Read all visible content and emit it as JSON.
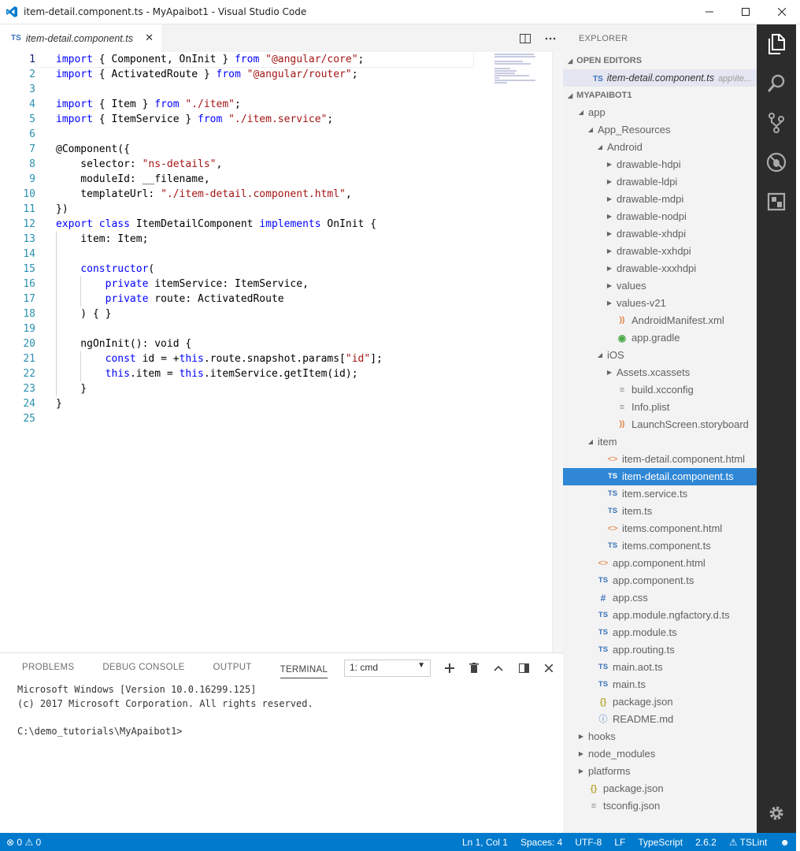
{
  "window": {
    "title": "item-detail.component.ts - MyApaibot1 - Visual Studio Code"
  },
  "tab": {
    "badge": "TS",
    "name": "item-detail.component.ts"
  },
  "editor": {
    "lines": [
      {
        "n": "1",
        "tokens": [
          [
            "kw",
            "import"
          ],
          [
            "t",
            " { Component, OnInit } "
          ],
          [
            "kw",
            "from"
          ],
          [
            "t",
            " "
          ],
          [
            "str",
            "\"@angular/core\""
          ],
          [
            "t",
            ";"
          ]
        ]
      },
      {
        "n": "2",
        "tokens": [
          [
            "kw",
            "import"
          ],
          [
            "t",
            " { ActivatedRoute } "
          ],
          [
            "kw",
            "from"
          ],
          [
            "t",
            " "
          ],
          [
            "str",
            "\"@angular/router\""
          ],
          [
            "t",
            ";"
          ]
        ]
      },
      {
        "n": "3",
        "tokens": []
      },
      {
        "n": "4",
        "tokens": [
          [
            "kw",
            "import"
          ],
          [
            "t",
            " { Item } "
          ],
          [
            "kw",
            "from"
          ],
          [
            "t",
            " "
          ],
          [
            "str",
            "\"./item\""
          ],
          [
            "t",
            ";"
          ]
        ]
      },
      {
        "n": "5",
        "tokens": [
          [
            "kw",
            "import"
          ],
          [
            "t",
            " { ItemService } "
          ],
          [
            "kw",
            "from"
          ],
          [
            "t",
            " "
          ],
          [
            "str",
            "\"./item.service\""
          ],
          [
            "t",
            ";"
          ]
        ]
      },
      {
        "n": "6",
        "tokens": []
      },
      {
        "n": "7",
        "tokens": [
          [
            "t",
            "@Component({"
          ]
        ]
      },
      {
        "n": "8",
        "tokens": [
          [
            "t",
            "    selector: "
          ],
          [
            "str",
            "\"ns-details\""
          ],
          [
            "t",
            ","
          ]
        ]
      },
      {
        "n": "9",
        "tokens": [
          [
            "t",
            "    moduleId: __filename,"
          ]
        ]
      },
      {
        "n": "10",
        "tokens": [
          [
            "t",
            "    templateUrl: "
          ],
          [
            "str",
            "\"./item-detail.component.html\""
          ],
          [
            "t",
            ","
          ]
        ]
      },
      {
        "n": "11",
        "tokens": [
          [
            "t",
            "})"
          ]
        ]
      },
      {
        "n": "12",
        "tokens": [
          [
            "kw",
            "export"
          ],
          [
            "t",
            " "
          ],
          [
            "kw",
            "class"
          ],
          [
            "t",
            " ItemDetailComponent "
          ],
          [
            "kw",
            "implements"
          ],
          [
            "t",
            " OnInit {"
          ]
        ]
      },
      {
        "n": "13",
        "tokens": [
          [
            "t",
            "    item: Item;"
          ]
        ]
      },
      {
        "n": "14",
        "tokens": []
      },
      {
        "n": "15",
        "tokens": [
          [
            "t",
            "    "
          ],
          [
            "kw",
            "constructor"
          ],
          [
            "t",
            "("
          ]
        ]
      },
      {
        "n": "16",
        "tokens": [
          [
            "t",
            "        "
          ],
          [
            "kw",
            "private"
          ],
          [
            "t",
            " itemService: ItemService,"
          ]
        ]
      },
      {
        "n": "17",
        "tokens": [
          [
            "t",
            "        "
          ],
          [
            "kw",
            "private"
          ],
          [
            "t",
            " route: ActivatedRoute"
          ]
        ]
      },
      {
        "n": "18",
        "tokens": [
          [
            "t",
            "    ) { }"
          ]
        ]
      },
      {
        "n": "19",
        "tokens": []
      },
      {
        "n": "20",
        "tokens": [
          [
            "t",
            "    ngOnInit(): void {"
          ]
        ]
      },
      {
        "n": "21",
        "tokens": [
          [
            "t",
            "        "
          ],
          [
            "kw",
            "const"
          ],
          [
            "t",
            " id = +"
          ],
          [
            "kw",
            "this"
          ],
          [
            "t",
            ".route.snapshot.params["
          ],
          [
            "str",
            "\"id\""
          ],
          [
            "t",
            "];"
          ]
        ]
      },
      {
        "n": "22",
        "tokens": [
          [
            "t",
            "        "
          ],
          [
            "kw",
            "this"
          ],
          [
            "t",
            ".item = "
          ],
          [
            "kw",
            "this"
          ],
          [
            "t",
            ".itemService.getItem(id);"
          ]
        ]
      },
      {
        "n": "23",
        "tokens": [
          [
            "t",
            "    }"
          ]
        ]
      },
      {
        "n": "24",
        "tokens": [
          [
            "t",
            "}"
          ]
        ]
      },
      {
        "n": "25",
        "tokens": []
      }
    ]
  },
  "panel": {
    "tabs": [
      "PROBLEMS",
      "DEBUG CONSOLE",
      "OUTPUT",
      "TERMINAL"
    ],
    "active_tab": "TERMINAL",
    "terminal_select": "1: cmd",
    "terminal_lines": [
      "Microsoft Windows [Version 10.0.16299.125]",
      "(c) 2017 Microsoft Corporation. All rights reserved.",
      "",
      "C:\\demo_tutorials\\MyApaibot1>"
    ]
  },
  "explorer": {
    "title": "EXPLORER",
    "open_editors_label": "OPEN EDITORS",
    "open_editor": {
      "badge": "TS",
      "name": "item-detail.component.ts",
      "path": "app\\ite..."
    },
    "project_label": "MYAPAIBOT1",
    "tree": [
      {
        "label": "app",
        "depth": 0,
        "twisty": "open",
        "icon": ""
      },
      {
        "label": "App_Resources",
        "depth": 1,
        "twisty": "open",
        "icon": ""
      },
      {
        "label": "Android",
        "depth": 2,
        "twisty": "open",
        "icon": ""
      },
      {
        "label": "drawable-hdpi",
        "depth": 3,
        "twisty": "closed",
        "icon": ""
      },
      {
        "label": "drawable-ldpi",
        "depth": 3,
        "twisty": "closed",
        "icon": ""
      },
      {
        "label": "drawable-mdpi",
        "depth": 3,
        "twisty": "closed",
        "icon": ""
      },
      {
        "label": "drawable-nodpi",
        "depth": 3,
        "twisty": "closed",
        "icon": ""
      },
      {
        "label": "drawable-xhdpi",
        "depth": 3,
        "twisty": "closed",
        "icon": ""
      },
      {
        "label": "drawable-xxhdpi",
        "depth": 3,
        "twisty": "closed",
        "icon": ""
      },
      {
        "label": "drawable-xxxhdpi",
        "depth": 3,
        "twisty": "closed",
        "icon": ""
      },
      {
        "label": "values",
        "depth": 3,
        "twisty": "closed",
        "icon": ""
      },
      {
        "label": "values-v21",
        "depth": 3,
        "twisty": "closed",
        "icon": ""
      },
      {
        "label": "AndroidManifest.xml",
        "depth": 3,
        "twisty": "none",
        "icon": "rss"
      },
      {
        "label": "app.gradle",
        "depth": 3,
        "twisty": "none",
        "icon": "gradle"
      },
      {
        "label": "iOS",
        "depth": 2,
        "twisty": "open",
        "icon": ""
      },
      {
        "label": "Assets.xcassets",
        "depth": 3,
        "twisty": "closed",
        "icon": ""
      },
      {
        "label": "build.xcconfig",
        "depth": 3,
        "twisty": "none",
        "icon": "doc"
      },
      {
        "label": "Info.plist",
        "depth": 3,
        "twisty": "none",
        "icon": "doc"
      },
      {
        "label": "LaunchScreen.storyboard",
        "depth": 3,
        "twisty": "none",
        "icon": "rss"
      },
      {
        "label": "item",
        "depth": 1,
        "twisty": "open",
        "icon": ""
      },
      {
        "label": "item-detail.component.html",
        "depth": 2,
        "twisty": "none",
        "icon": "html"
      },
      {
        "label": "item-detail.component.ts",
        "depth": 2,
        "twisty": "none",
        "icon": "ts",
        "selected": true
      },
      {
        "label": "item.service.ts",
        "depth": 2,
        "twisty": "none",
        "icon": "ts"
      },
      {
        "label": "item.ts",
        "depth": 2,
        "twisty": "none",
        "icon": "ts"
      },
      {
        "label": "items.component.html",
        "depth": 2,
        "twisty": "none",
        "icon": "html"
      },
      {
        "label": "items.component.ts",
        "depth": 2,
        "twisty": "none",
        "icon": "ts"
      },
      {
        "label": "app.component.html",
        "depth": 1,
        "twisty": "none",
        "icon": "html"
      },
      {
        "label": "app.component.ts",
        "depth": 1,
        "twisty": "none",
        "icon": "ts"
      },
      {
        "label": "app.css",
        "depth": 1,
        "twisty": "none",
        "icon": "css"
      },
      {
        "label": "app.module.ngfactory.d.ts",
        "depth": 1,
        "twisty": "none",
        "icon": "ts"
      },
      {
        "label": "app.module.ts",
        "depth": 1,
        "twisty": "none",
        "icon": "ts"
      },
      {
        "label": "app.routing.ts",
        "depth": 1,
        "twisty": "none",
        "icon": "ts"
      },
      {
        "label": "main.aot.ts",
        "depth": 1,
        "twisty": "none",
        "icon": "ts"
      },
      {
        "label": "main.ts",
        "depth": 1,
        "twisty": "none",
        "icon": "ts"
      },
      {
        "label": "package.json",
        "depth": 1,
        "twisty": "none",
        "icon": "json"
      },
      {
        "label": "README.md",
        "depth": 1,
        "twisty": "none",
        "icon": "info"
      },
      {
        "label": "hooks",
        "depth": 0,
        "twisty": "closed",
        "icon": ""
      },
      {
        "label": "node_modules",
        "depth": 0,
        "twisty": "closed",
        "icon": ""
      },
      {
        "label": "platforms",
        "depth": 0,
        "twisty": "closed",
        "icon": ""
      },
      {
        "label": "package.json",
        "depth": 0,
        "twisty": "none",
        "icon": "json"
      },
      {
        "label": "tsconfig.json",
        "depth": 0,
        "twisty": "none",
        "icon": "doc"
      }
    ]
  },
  "icon_glyphs": {
    "ts": "TS",
    "html": "<>",
    "rss": "))",
    "gradle": "◉",
    "doc": "≡",
    "css": "#",
    "json": "{}",
    "info": "ⓘ"
  },
  "statusbar": {
    "errors": "0",
    "warnings": "0",
    "position": "Ln 1, Col 1",
    "spaces": "Spaces: 4",
    "encoding": "UTF-8",
    "eol": "LF",
    "language": "TypeScript",
    "version": "2.6.2",
    "linter": "TSLint"
  },
  "colors": {
    "accent": "#007acc",
    "selection": "#2f87d6",
    "keyword": "#0000ff",
    "string": "#a31515",
    "line_number": "#2b91af"
  }
}
